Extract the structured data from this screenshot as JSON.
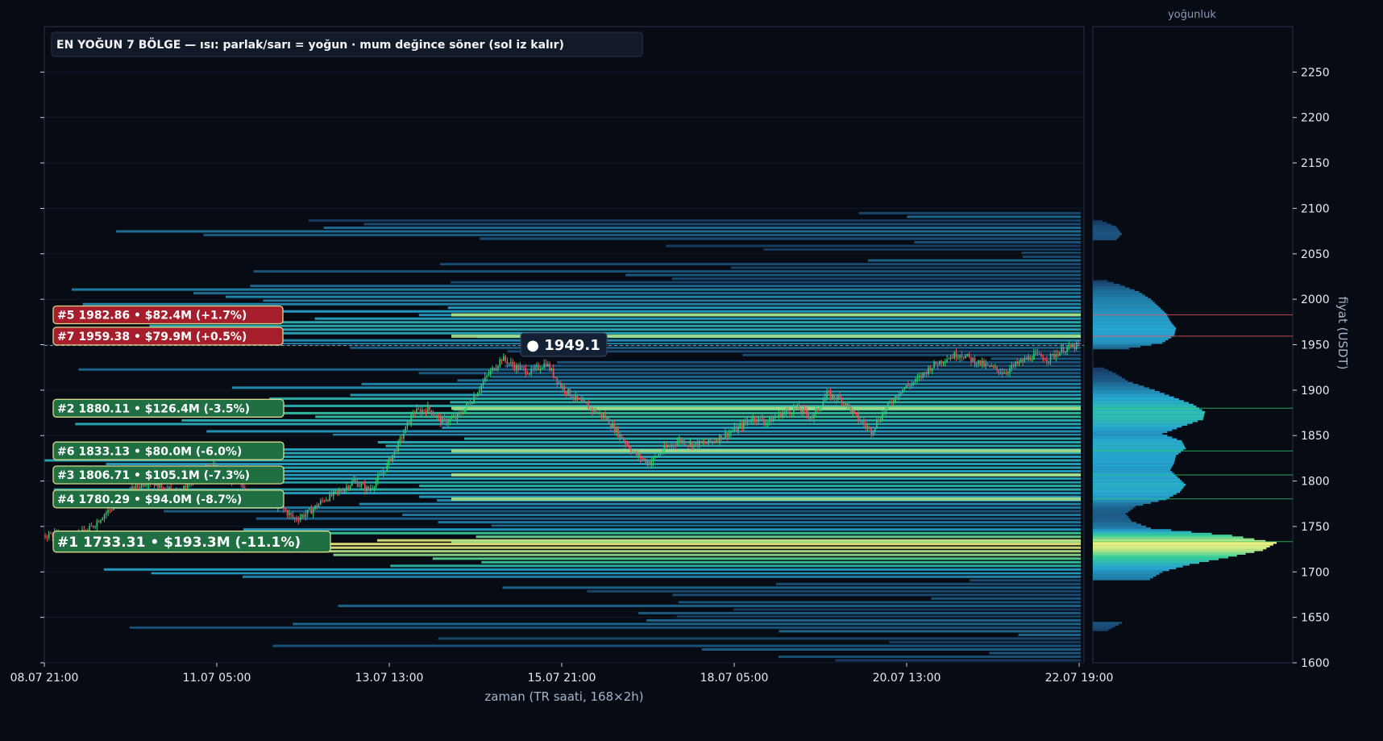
{
  "chart_data": {
    "type": "heatmap",
    "title": "EN YOĞUN 7 BÖLGE — ısı: parlak/sarı = yoğun · mum değince söner (sol iz kalır)",
    "xlabel": "zaman (TR saati, 168×2h)",
    "ylabel": "fiyat (USDT)",
    "profile_title": "yoğunluk",
    "ylim": [
      1600,
      2300
    ],
    "y_ticks": [
      1600,
      1650,
      1700,
      1750,
      1800,
      1850,
      1900,
      1950,
      2000,
      2050,
      2100,
      2150,
      2200,
      2250
    ],
    "x_tick_labels": [
      "08.07 21:00",
      "11.07 05:00",
      "13.07 13:00",
      "15.07 21:00",
      "18.07 05:00",
      "20.07 13:00",
      "22.07 19:00"
    ],
    "current_price": 1949.1,
    "current_price_label": "● 1949.1",
    "zones": [
      {
        "rank": 1,
        "label": "#1  1733.31  •  $193.3M  (-11.1%)",
        "price": 1733.31,
        "value_musd": 193.3,
        "pct": -11.1,
        "side": "support",
        "color": "#1f6f43"
      },
      {
        "rank": 2,
        "label": "#2  1880.11  •  $126.4M  (-3.5%)",
        "price": 1880.11,
        "value_musd": 126.4,
        "pct": -3.5,
        "side": "support",
        "color": "#1f6f43"
      },
      {
        "rank": 3,
        "label": "#3  1806.71  •  $105.1M  (-7.3%)",
        "price": 1806.71,
        "value_musd": 105.1,
        "pct": -7.3,
        "side": "support",
        "color": "#1f6f43"
      },
      {
        "rank": 4,
        "label": "#4  1780.29  •  $94.0M  (-8.7%)",
        "price": 1780.29,
        "value_musd": 94.0,
        "pct": -8.7,
        "side": "support",
        "color": "#1f6f43"
      },
      {
        "rank": 5,
        "label": "#5  1982.86  •  $82.4M  (+1.7%)",
        "price": 1982.86,
        "value_musd": 82.4,
        "pct": 1.7,
        "side": "resistance",
        "color": "#a61e2b"
      },
      {
        "rank": 6,
        "label": "#6  1833.13  •  $80.0M  (-6.0%)",
        "price": 1833.13,
        "value_musd": 80.0,
        "pct": -6.0,
        "side": "support",
        "color": "#1f6f43"
      },
      {
        "rank": 7,
        "label": "#7  1959.38  •  $79.9M  (+0.5%)",
        "price": 1959.38,
        "value_musd": 79.9,
        "pct": 0.5,
        "side": "resistance",
        "color": "#a61e2b"
      }
    ],
    "candles_close_path": [
      1740,
      1742,
      1738,
      1745,
      1762,
      1775,
      1790,
      1800,
      1795,
      1785,
      1798,
      1820,
      1810,
      1800,
      1785,
      1780,
      1772,
      1758,
      1766,
      1780,
      1788,
      1800,
      1790,
      1810,
      1840,
      1875,
      1880,
      1865,
      1870,
      1890,
      1915,
      1935,
      1925,
      1920,
      1930,
      1905,
      1890,
      1880,
      1870,
      1850,
      1830,
      1820,
      1835,
      1845,
      1840,
      1842,
      1850,
      1858,
      1870,
      1865,
      1875,
      1880,
      1870,
      1895,
      1890,
      1870,
      1855,
      1880,
      1900,
      1910,
      1925,
      1935,
      1940,
      1932,
      1925,
      1920,
      1930,
      1938,
      1935,
      1945,
      1949
    ],
    "profile_density": [
      [
        1636,
        0.08
      ],
      [
        1645,
        0.16
      ],
      [
        1660,
        0.2
      ],
      [
        1675,
        0.19
      ],
      [
        1690,
        0.28
      ],
      [
        1700,
        0.36
      ],
      [
        1708,
        0.5
      ],
      [
        1716,
        0.7
      ],
      [
        1724,
        0.88
      ],
      [
        1732,
        0.95
      ],
      [
        1740,
        0.72
      ],
      [
        1748,
        0.3
      ],
      [
        1756,
        0.2
      ],
      [
        1764,
        0.17
      ],
      [
        1772,
        0.22
      ],
      [
        1780,
        0.38
      ],
      [
        1788,
        0.45
      ],
      [
        1796,
        0.48
      ],
      [
        1804,
        0.44
      ],
      [
        1812,
        0.4
      ],
      [
        1820,
        0.42
      ],
      [
        1828,
        0.43
      ],
      [
        1836,
        0.48
      ],
      [
        1844,
        0.46
      ],
      [
        1852,
        0.36
      ],
      [
        1860,
        0.46
      ],
      [
        1868,
        0.57
      ],
      [
        1876,
        0.58
      ],
      [
        1884,
        0.52
      ],
      [
        1892,
        0.42
      ],
      [
        1900,
        0.32
      ],
      [
        1910,
        0.18
      ],
      [
        1918,
        0.12
      ],
      [
        1925,
        0.05
      ],
      [
        1945,
        0.16
      ],
      [
        1952,
        0.36
      ],
      [
        1960,
        0.42
      ],
      [
        1968,
        0.43
      ],
      [
        1976,
        0.4
      ],
      [
        1984,
        0.38
      ],
      [
        1992,
        0.34
      ],
      [
        2000,
        0.3
      ],
      [
        2008,
        0.24
      ],
      [
        2016,
        0.14
      ],
      [
        2021,
        0.06
      ],
      [
        2065,
        0.12
      ],
      [
        2072,
        0.15
      ],
      [
        2080,
        0.12
      ],
      [
        2086,
        0.05
      ]
    ],
    "colors": {
      "background": "#070b13",
      "panel_border": "#2b3346",
      "bull": "#2ecc71",
      "bear": "#f0505f",
      "heat_low": "#152a55",
      "heat_mid": "#26a5d0",
      "heat_high": "#36d19b",
      "heat_top": "#f4f07e",
      "grid": "#121a28"
    }
  }
}
